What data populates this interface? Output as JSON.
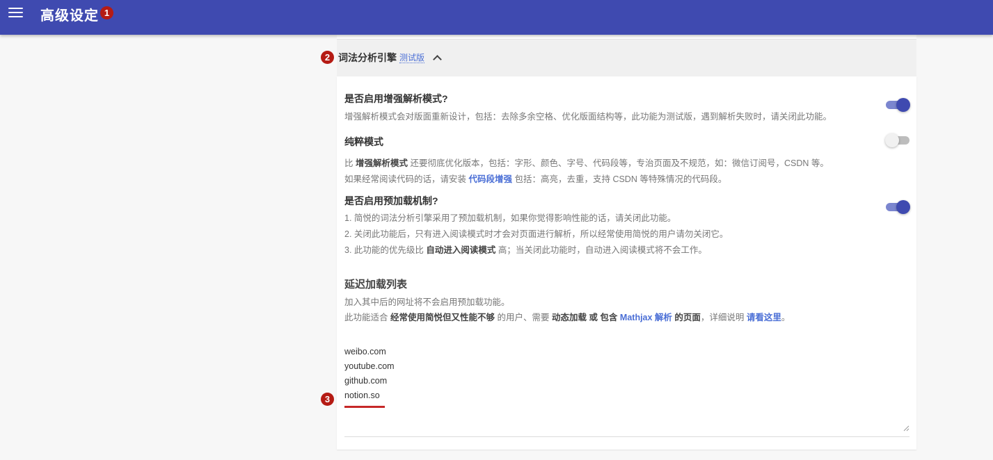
{
  "appbar": {
    "title": "高级设定",
    "badge": "1",
    "menu_icon": "hamburger-menu-icon",
    "color": "#3f4ab0"
  },
  "section": {
    "badge": "2",
    "title": "词法分析引擎",
    "beta_label": "测试版",
    "chevron_icon": "chevron-up-icon"
  },
  "options": [
    {
      "title": "是否启用增强解析模式?",
      "desc": "增强解析模式会对版面重新设计，包括：去除多余空格、优化版面结构等，此功能为测试版，遇到解析失败时，请关闭此功能。",
      "enabled": true
    },
    {
      "title": "纯粹模式",
      "desc1_pre": "比 ",
      "desc1_bold": "增强解析模式",
      "desc1_post": " 还要彻底优化版本，包括：字形、颜色、字号、代码段等，专治页面及不规范，如：微信订阅号，CSDN 等。",
      "desc2_pre": "如果经常阅读代码的话，请安装 ",
      "desc2_link": "代码段增强",
      "desc2_post": " 包括：高亮，去重，支持 CSDN 等特殊情况的代码段。",
      "enabled": false
    },
    {
      "title": "是否启用预加载机制?",
      "line1": "1. 简悦的词法分析引擎采用了预加载机制，如果你觉得影响性能的话，请关闭此功能。",
      "line2": "2. 关闭此功能后，只有进入阅读模式时才会对页面进行解析，所以经常使用简悦的用户请勿关闭它。",
      "line3_pre": "3. 此功能的优先级比 ",
      "line3_bold": "自动进入阅读模式",
      "line3_post": " 高；当关闭此功能时，自动进入阅读模式将不会工作。",
      "enabled": true
    }
  ],
  "delay_list": {
    "title": "延迟加载列表",
    "desc1": "加入其中后的网址将不会启用预加载功能。",
    "desc2_pre": "此功能适合 ",
    "desc2_bold1": "经常使用简悦但又性能不够",
    "desc2_mid1": " 的用户、需要 ",
    "desc2_bold2": "动态加载",
    "desc2_or": " 或 ",
    "desc2_bold3": "包含",
    "desc2_link1": " Mathjax 解析",
    "desc2_bold4": " 的页面",
    "desc2_mid2": "，详细说明 ",
    "desc2_link2": "请看这里",
    "desc2_end": "。",
    "badge": "3",
    "domains": [
      "weibo.com",
      "youtube.com",
      "github.com",
      "notion.so"
    ]
  }
}
